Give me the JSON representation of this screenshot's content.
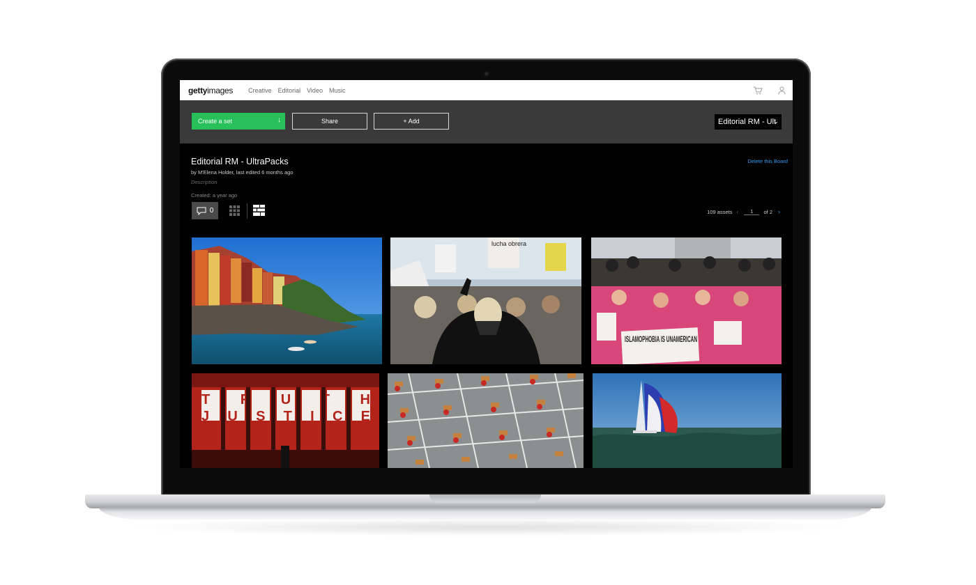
{
  "nav": {
    "logo_bold": "getty",
    "logo_light": "images",
    "links": [
      "Creative",
      "Editorial",
      "Video",
      "Music"
    ],
    "icons": [
      "cart-icon",
      "user-icon"
    ]
  },
  "toolbar": {
    "create_label": "Create a set",
    "create_icon": "download-arrow-icon",
    "share_label": "Share",
    "add_label": "+ Add",
    "board_select": "Editorial RM - Ult"
  },
  "board": {
    "title": "Editorial RM - UltraPacks",
    "byline": "by M'Elena Holder, last edited 6 months ago",
    "description_placeholder": "Description",
    "created": "Created: a year ago",
    "delete_label": "Delete this Board",
    "comment_count": "0"
  },
  "pager": {
    "assets": "109 assets",
    "page": "1",
    "of": "of 2"
  },
  "colors": {
    "accent_green": "#27c05a",
    "link_blue": "#2f9cf0",
    "toolbar_bg": "#3a3a3a"
  },
  "thumbnails": {
    "t4_banner_top": "TRUTH",
    "t4_banner_bottom": "JUSTICE",
    "t3_sign": "ISLAMOPHOBIA IS UNAMERICAN",
    "t2_sign": "lucha obrera"
  }
}
